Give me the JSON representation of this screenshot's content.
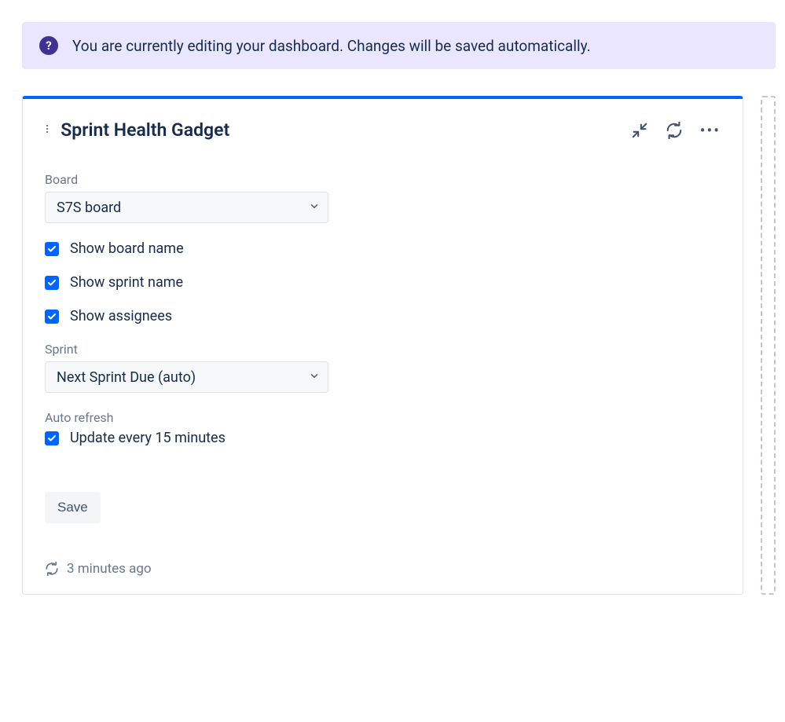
{
  "banner": {
    "message": "You are currently editing your dashboard. Changes will be saved automatically."
  },
  "gadget": {
    "title": "Sprint Health Gadget",
    "form": {
      "board_label": "Board",
      "board_value": "S7S board",
      "checkboxes": [
        {
          "label": "Show board name",
          "checked": true
        },
        {
          "label": "Show sprint name",
          "checked": true
        },
        {
          "label": "Show assignees",
          "checked": true
        }
      ],
      "sprint_label": "Sprint",
      "sprint_value": "Next Sprint Due (auto)",
      "auto_refresh_label": "Auto refresh",
      "auto_refresh_checkbox": "Update every 15 minutes",
      "save_label": "Save"
    },
    "footer_time": "3 minutes ago"
  }
}
